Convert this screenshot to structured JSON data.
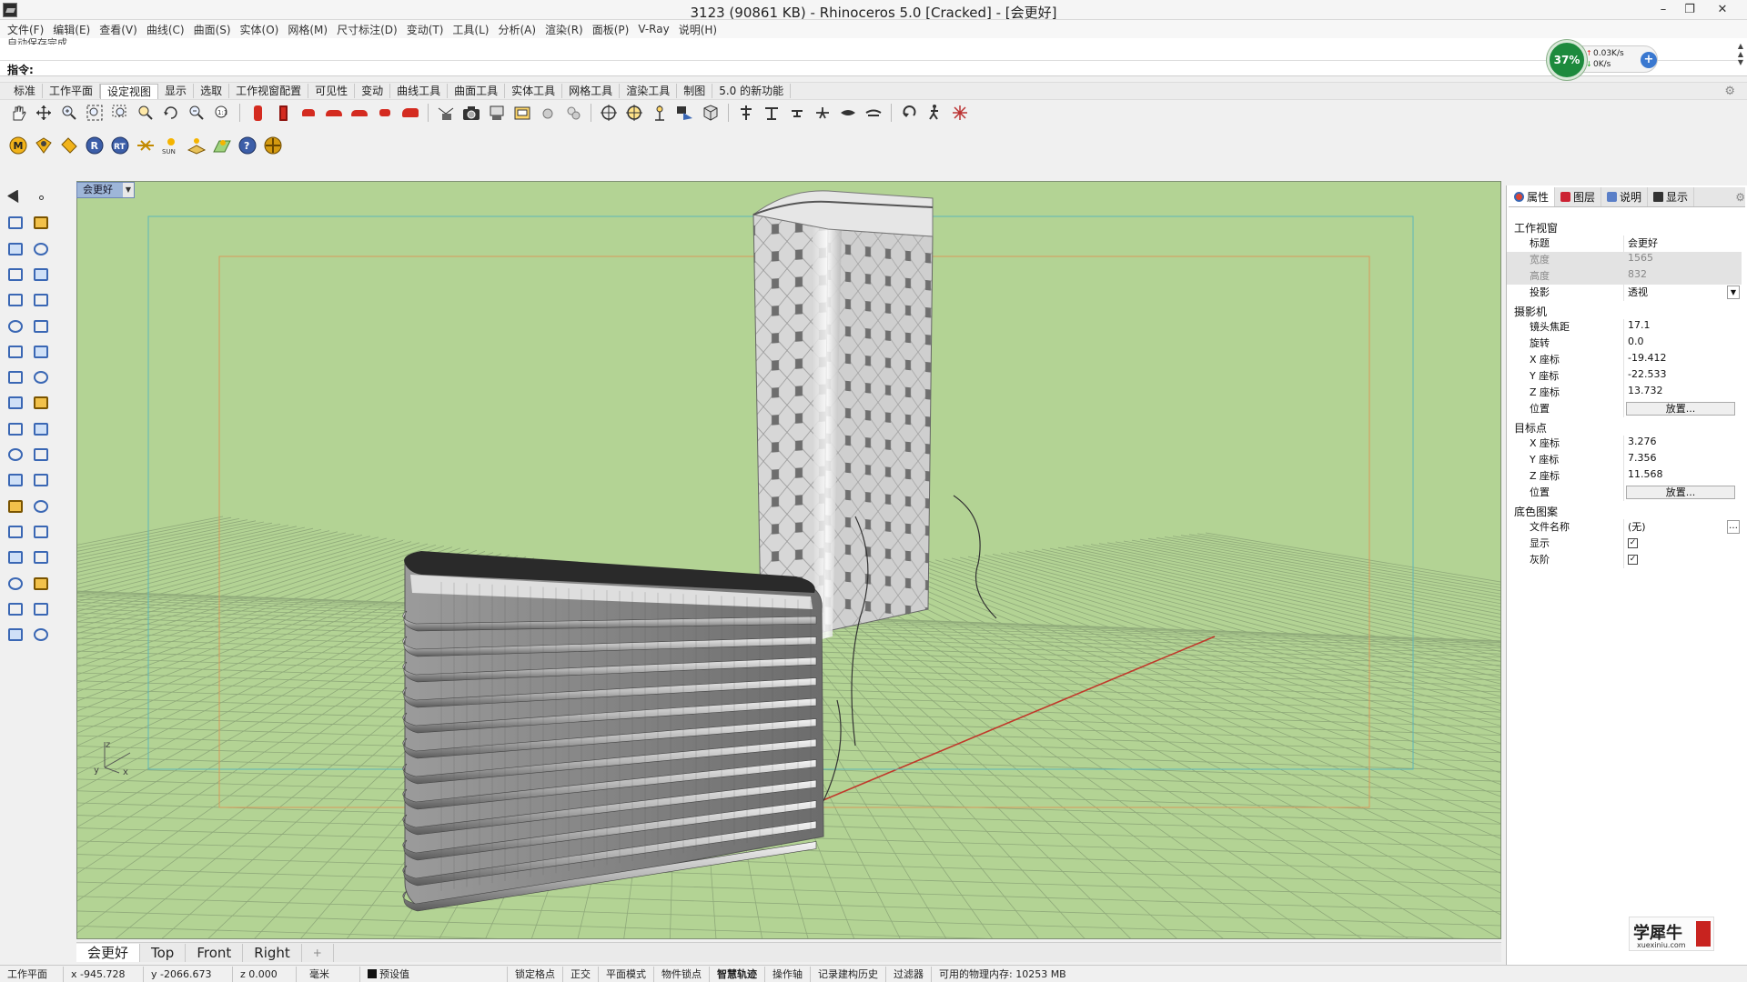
{
  "window": {
    "title": "3123 (90861 KB) - Rhinoceros 5.0 [Cracked] - [会更好]",
    "controls": [
      "–",
      "❐",
      "✕"
    ]
  },
  "menu": [
    "文件(F)",
    "编辑(E)",
    "查看(V)",
    "曲线(C)",
    "曲面(S)",
    "实体(O)",
    "网格(M)",
    "尺寸标注(D)",
    "变动(T)",
    "工具(L)",
    "分析(A)",
    "渲染(R)",
    "面板(P)",
    "V-Ray",
    "说明(H)"
  ],
  "command": {
    "history": "自动保存完成",
    "prompt": "指令:"
  },
  "perf": {
    "percent": "37%",
    "up": "0.03K/s",
    "down": "0K/s",
    "plus": "+"
  },
  "tabs": [
    "标准",
    "工作平面",
    "设定视图",
    "显示",
    "选取",
    "工作视窗配置",
    "可见性",
    "变动",
    "曲线工具",
    "曲面工具",
    "实体工具",
    "网格工具",
    "渲染工具",
    "制图",
    "5.0 的新功能"
  ],
  "active_tab": "设定视图",
  "vray_toolbar": {
    "sun_label": "SUN",
    "rt_label": "RT",
    "r_label": "R",
    "m_label": "M"
  },
  "viewport": {
    "name": "会更好",
    "axis_x": "x",
    "axis_y": "y",
    "axis_z": "z"
  },
  "viewport_tabs": [
    "会更好",
    "Top",
    "Front",
    "Right"
  ],
  "viewport_tab_add": "+",
  "status": {
    "cplane": "工作平面",
    "x": "x -945.728",
    "y": "y -2066.673",
    "z": "z 0.000",
    "unit": "毫米",
    "layer": "预设值",
    "snap": "锁定格点",
    "ortho": "正交",
    "planar": "平面模式",
    "osnap": "物件锁点",
    "smarttrack": "智慧轨迹",
    "gumball": "操作轴",
    "history": "记录建构历史",
    "filter": "过滤器",
    "memory": "可用的物理内存: 10253 MB"
  },
  "panel": {
    "tabs": [
      "属性",
      "图层",
      "说明",
      "显示"
    ],
    "section_viewport": "工作视窗",
    "title_k": "标题",
    "title_v": "会更好",
    "width_k": "宽度",
    "width_v": "1565",
    "height_k": "高度",
    "height_v": "832",
    "proj_k": "投影",
    "proj_v": "透视",
    "section_camera": "摄影机",
    "lens_k": "镜头焦距",
    "lens_v": "17.1",
    "rot_k": "旋转",
    "rot_v": "0.0",
    "cx_k": "X 座标",
    "cx_v": "-19.412",
    "cy_k": "Y 座标",
    "cy_v": "-22.533",
    "cz_k": "Z 座标",
    "cz_v": "13.732",
    "cpos_k": "位置",
    "cpos_btn": "放置...",
    "section_target": "目标点",
    "tx_k": "X 座标",
    "tx_v": "3.276",
    "ty_k": "Y 座标",
    "ty_v": "7.356",
    "tz_k": "Z 座标",
    "tz_v": "11.568",
    "tpos_k": "位置",
    "tpos_btn": "放置...",
    "section_wall": "底色图案",
    "file_k": "文件名称",
    "file_v": "(无)",
    "show_k": "显示",
    "gray_k": "灰阶"
  },
  "watermark": {
    "big": "学犀牛",
    "small": "xuexiniu.com"
  },
  "colors": {
    "viewport_bg": "#b3d394",
    "grid": "#8fa97a",
    "axis_red": "#c0392b",
    "axis_green": "#3f8f3f",
    "accent_tab": "#9eb6d8"
  }
}
